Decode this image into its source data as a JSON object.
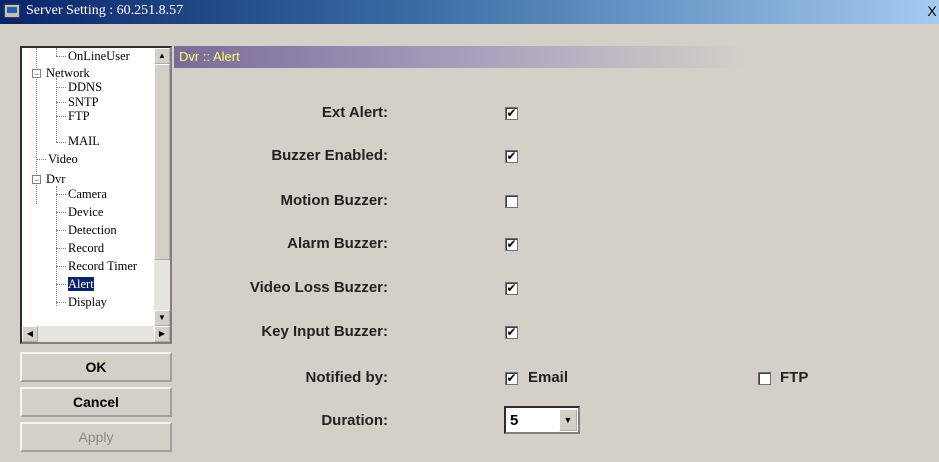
{
  "window": {
    "title": "Server Setting : 60.251.8.57",
    "close": "X"
  },
  "tree": {
    "items": [
      {
        "label": "OnLineUser"
      },
      {
        "label": "Network"
      },
      {
        "label": "DDNS"
      },
      {
        "label": "SNTP"
      },
      {
        "label": "FTP"
      },
      {
        "label": "MAIL"
      },
      {
        "label": "Video"
      },
      {
        "label": "Dvr"
      },
      {
        "label": "Camera"
      },
      {
        "label": "Device"
      },
      {
        "label": "Detection"
      },
      {
        "label": "Record"
      },
      {
        "label": "Record Timer"
      },
      {
        "label": "Alert"
      },
      {
        "label": "Display"
      }
    ],
    "expanders": {
      "network": "−",
      "dvr": "−"
    }
  },
  "buttons": {
    "ok": "OK",
    "cancel": "Cancel",
    "apply": "Apply"
  },
  "panel": {
    "header": "Dvr :: Alert",
    "fields": [
      {
        "label": "Ext Alert:",
        "checked": true
      },
      {
        "label": "Buzzer Enabled:",
        "checked": true
      },
      {
        "label": "Motion Buzzer:",
        "checked": false
      },
      {
        "label": "Alarm Buzzer:",
        "checked": true
      },
      {
        "label": "Video Loss Buzzer:",
        "checked": true
      },
      {
        "label": "Key Input Buzzer:",
        "checked": true
      }
    ],
    "notified": {
      "label": "Notified by:",
      "email_label": "Email",
      "email_checked": true,
      "ftp_label": "FTP",
      "ftp_checked": false
    },
    "duration": {
      "label": "Duration:",
      "value": "5"
    },
    "check_glyph": "✔"
  }
}
